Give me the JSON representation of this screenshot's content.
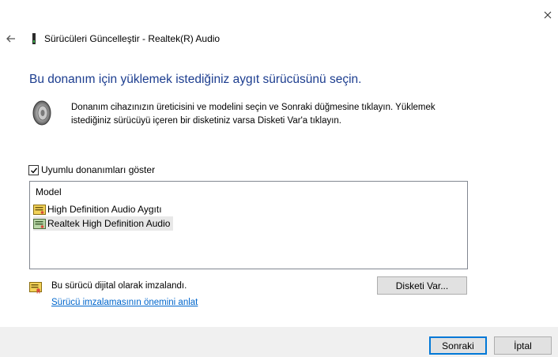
{
  "window": {
    "title": "Sürücüleri Güncelleştir - Realtek(R) Audio"
  },
  "heading": "Bu donanım için yüklemek istediğiniz aygıt sürücüsünü seçin.",
  "description": [
    "Donanım cihazınızın üreticisini ve modelini seçin ve Sonraki düğmesine tıklayın. Yüklemek",
    "istediğiniz sürücüyü içeren bir disketiniz varsa Disketi Var'a tıklayın."
  ],
  "compat_checkbox": {
    "label": "Uyumlu donanımları göster",
    "checked": true
  },
  "model_list": {
    "header": "Model",
    "items": [
      {
        "label": "High Definition Audio Aygıtı",
        "selected": false
      },
      {
        "label": "Realtek High Definition Audio",
        "selected": true
      }
    ]
  },
  "signature": {
    "text": "Bu sürücü dijital olarak imzalandı.",
    "link": "Sürücü imzalamasının önemini anlat"
  },
  "buttons": {
    "have_disk": "Disketi Var...",
    "next": "Sonraki",
    "cancel": "İptal"
  },
  "icons": {
    "close": "close-icon",
    "back": "back-arrow-icon",
    "device": "audio-device-icon",
    "speaker": "speaker-icon",
    "driver": "driver-certificate-icon"
  },
  "colors": {
    "heading": "#1c3d8f",
    "link": "#0066cc",
    "default_button_border": "#0078d7",
    "footer_bg": "#f0f0f0"
  }
}
